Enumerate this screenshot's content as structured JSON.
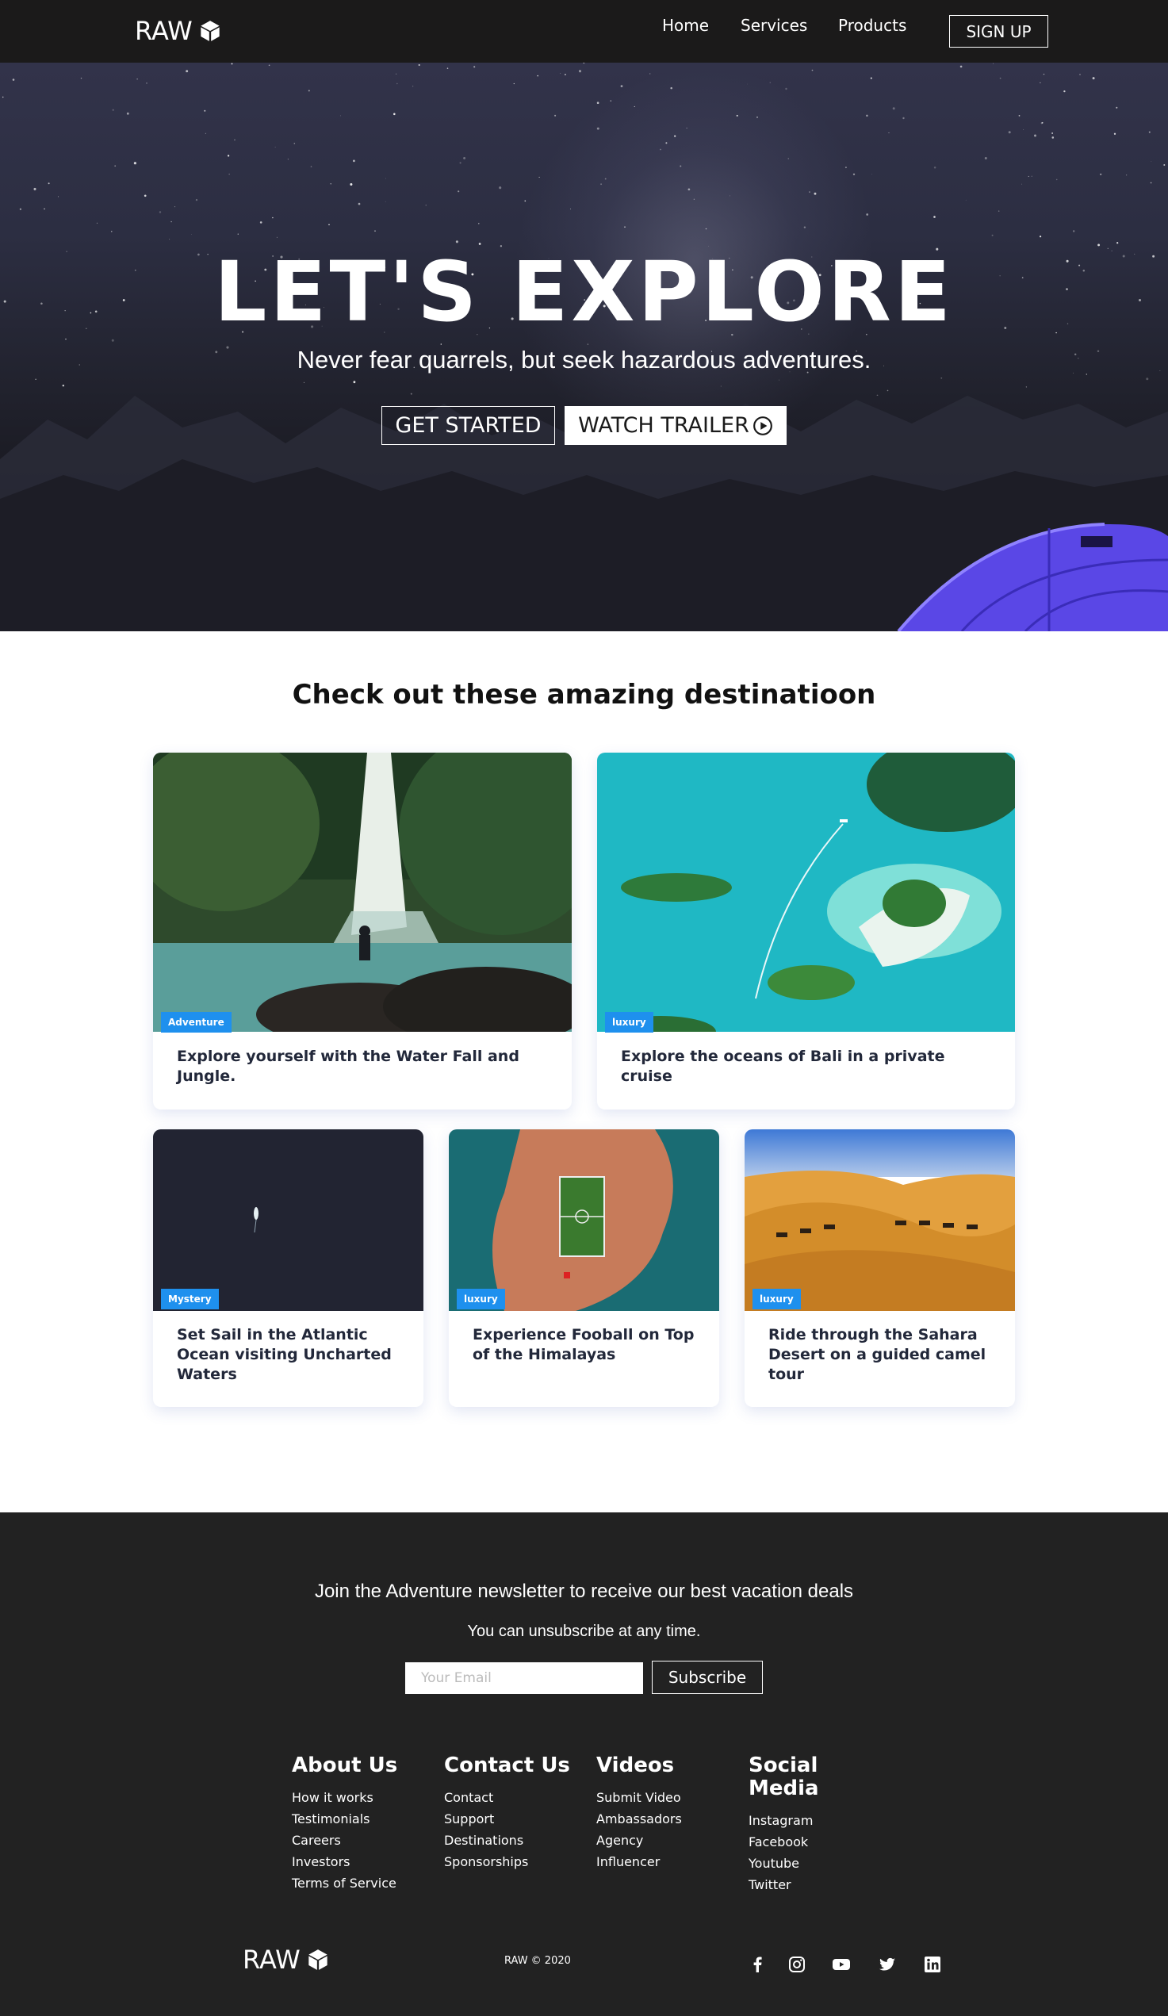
{
  "nav": {
    "logo_text": "RAW",
    "logo_icon": "cube-icon",
    "links": [
      "Home",
      "Services",
      "Products"
    ],
    "signup_label": "SIGN UP"
  },
  "hero": {
    "title": "LET'S EXPLORE",
    "subtitle": "Never fear quarrels, but seek hazardous adventures.",
    "get_started_label": "GET STARTED",
    "watch_trailer_label": "WATCH TRAILER",
    "watch_trailer_icon": "play-circle-icon"
  },
  "destinations": {
    "heading": "Check out these amazing destinatioon",
    "cards": [
      {
        "tag": "Adventure",
        "title": "Explore yourself with the Water Fall and Jungle."
      },
      {
        "tag": "luxury",
        "title": "Explore the oceans of Bali in a private cruise"
      },
      {
        "tag": "Mystery",
        "title": "Set Sail in the Atlantic Ocean visiting Uncharted Waters"
      },
      {
        "tag": "luxury",
        "title": "Experience Fooball on Top of the Himalayas"
      },
      {
        "tag": "luxury",
        "title": "Ride through the Sahara Desert on a guided camel tour"
      }
    ],
    "tag_color": "#1e90ee"
  },
  "newsletter": {
    "title": "Join the Adventure newsletter to receive our best vacation deals",
    "subtitle": "You can unsubscribe at any time.",
    "email_placeholder": "Your Email",
    "subscribe_label": "Subscribe"
  },
  "footer": {
    "columns": [
      {
        "heading": "About Us",
        "links": [
          "How it works",
          "Testimonials",
          "Careers",
          "Investors",
          "Terms of Service"
        ]
      },
      {
        "heading": "Contact Us",
        "links": [
          "Contact",
          "Support",
          "Destinations",
          "Sponsorships"
        ]
      },
      {
        "heading": "Videos",
        "links": [
          "Submit Video",
          "Ambassadors",
          "Agency",
          "Influencer"
        ]
      },
      {
        "heading": "Social Media",
        "links": [
          "Instagram",
          "Facebook",
          "Youtube",
          "Twitter"
        ]
      }
    ],
    "logo_text": "RAW",
    "copyright": "RAW © 2020",
    "social_icons": [
      "facebook-icon",
      "instagram-icon",
      "youtube-icon",
      "twitter-icon",
      "linkedin-icon"
    ],
    "background_color": "#222222"
  }
}
